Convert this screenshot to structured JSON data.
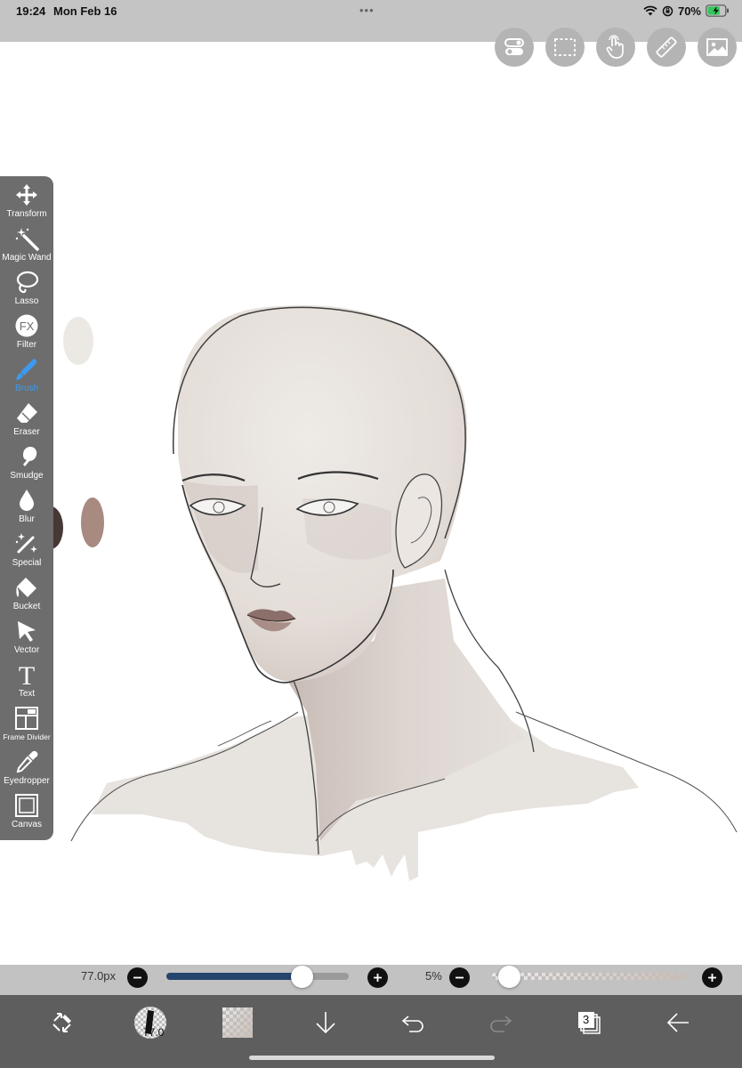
{
  "status_bar": {
    "time": "19:24",
    "date": "Mon Feb 16",
    "battery_percent": "70%",
    "icons": [
      "wifi-icon",
      "orientation-lock-icon",
      "battery-charging-icon"
    ]
  },
  "top_buttons": [
    {
      "name": "toggle-settings-button",
      "icon": "toggle-icon"
    },
    {
      "name": "selection-button",
      "icon": "dashed-rectangle-icon"
    },
    {
      "name": "gesture-button",
      "icon": "hand-touch-icon"
    },
    {
      "name": "ruler-button",
      "icon": "ruler-icon"
    },
    {
      "name": "reference-image-button",
      "icon": "image-icon"
    }
  ],
  "tools": [
    {
      "label": "Transform",
      "icon": "move-arrows-icon"
    },
    {
      "label": "Magic Wand",
      "icon": "magic-wand-icon"
    },
    {
      "label": "Lasso",
      "icon": "lasso-icon"
    },
    {
      "label": "Filter",
      "icon": "fx-icon"
    },
    {
      "label": "Brush",
      "icon": "brush-icon",
      "active": true
    },
    {
      "label": "Eraser",
      "icon": "eraser-icon"
    },
    {
      "label": "Smudge",
      "icon": "smudge-icon"
    },
    {
      "label": "Blur",
      "icon": "droplet-icon"
    },
    {
      "label": "Special",
      "icon": "sparkle-wand-icon"
    },
    {
      "label": "Bucket",
      "icon": "bucket-icon"
    },
    {
      "label": "Vector",
      "icon": "cursor-arrow-icon"
    },
    {
      "label": "Text",
      "icon": "text-t-icon"
    },
    {
      "label": "Frame Divider",
      "icon": "frame-divider-icon"
    },
    {
      "label": "Eyedropper",
      "icon": "eyedropper-icon"
    },
    {
      "label": "Canvas",
      "icon": "canvas-square-icon"
    }
  ],
  "brush_size": {
    "value_text": "77.0px",
    "level": 0.74
  },
  "opacity": {
    "value_text": "5%",
    "level": 0.05
  },
  "bottom_bar": {
    "brush_size_badge": "77.0",
    "layer_count": "3"
  },
  "colors": {
    "toolbar_bg": "#6d6d6d",
    "active_tool": "#3b9bf0",
    "size_slider_fill": "#26456e",
    "current_color": "#c8beb8",
    "bottom_bar_bg": "#5e5e5e"
  }
}
